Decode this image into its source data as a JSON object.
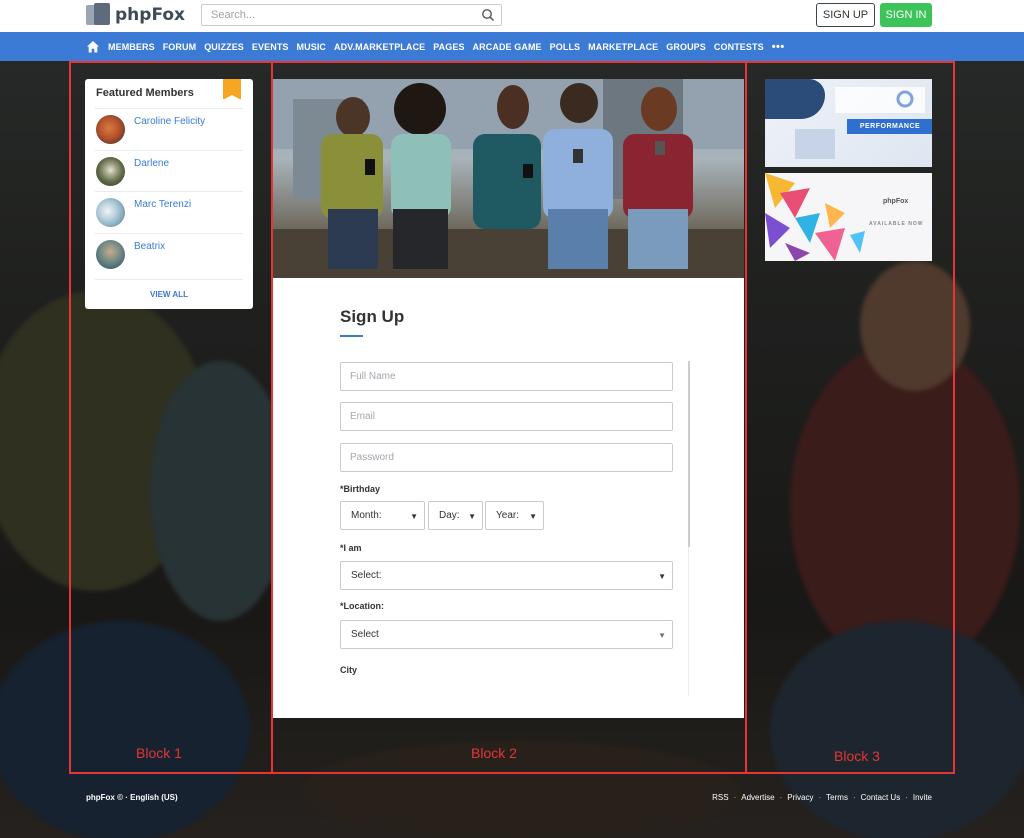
{
  "header": {
    "logo_text": "phpFox",
    "search_placeholder": "Search...",
    "signup_label": "SIGN UP",
    "signin_label": "SIGN IN"
  },
  "nav": {
    "items": [
      "MEMBERS",
      "FORUM",
      "QUIZZES",
      "EVENTS",
      "MUSIC",
      "ADV.MARKETPLACE",
      "PAGES",
      "ARCADE GAME",
      "POLLS",
      "MARKETPLACE",
      "GROUPS",
      "CONTESTS"
    ],
    "more": "•••"
  },
  "featured": {
    "title": "Featured Members",
    "members": [
      {
        "name": "Caroline Felicity",
        "avatar_color": "#b5532e"
      },
      {
        "name": "Darlene",
        "avatar_color": "#5f6b4a"
      },
      {
        "name": "Marc Terenzi",
        "avatar_color": "#8fb2c4"
      },
      {
        "name": "Beatrix",
        "avatar_color": "#4f6e7a"
      }
    ],
    "view_all": "VIEW ALL"
  },
  "signup_form": {
    "title": "Sign Up",
    "full_name_placeholder": "Full Name",
    "email_placeholder": "Email",
    "password_placeholder": "Password",
    "birthday_label": "*Birthday",
    "month": "Month:",
    "day": "Day:",
    "year": "Year:",
    "gender_label": "*I am",
    "gender_select": "Select:",
    "location_label": "*Location:",
    "location_select": "Select",
    "city_label": "City"
  },
  "ads": {
    "ad1_text": "PERFORMANCE",
    "ad2_brand": "phpFox",
    "ad2_text": "AVAILABLE NOW"
  },
  "blocks": [
    "Block 1",
    "Block 2",
    "Block 3"
  ],
  "footer": {
    "left": "phpFox © · English (US)",
    "links": [
      "RSS",
      "Advertise",
      "Privacy",
      "Terms",
      "Contact Us",
      "Invite"
    ]
  },
  "colors": {
    "brand_blue": "#3b7bd5",
    "signin_green": "#3cc45a",
    "annotation_red": "#e53535",
    "badge_orange": "#f5a623"
  }
}
